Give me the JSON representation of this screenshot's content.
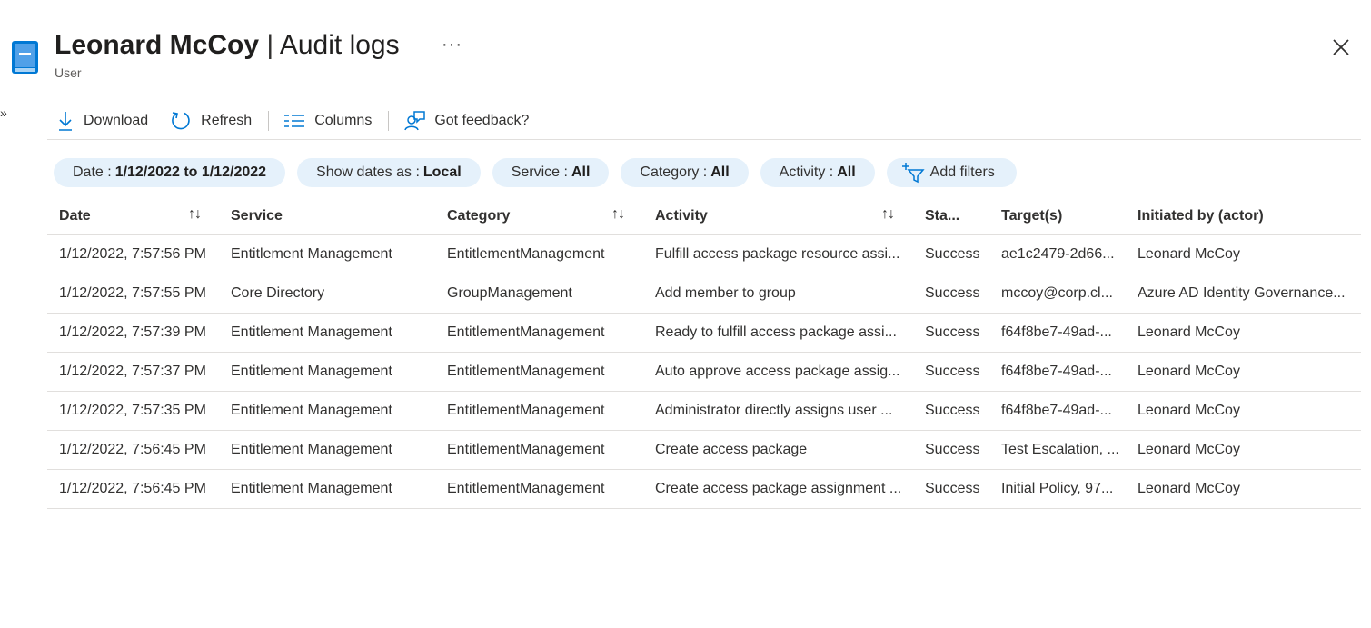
{
  "header": {
    "title_name": "Leonard McCoy",
    "title_sep": "|",
    "title_page": "Audit logs",
    "subtitle": "User",
    "more_label": "···"
  },
  "toolbar": {
    "download": "Download",
    "refresh": "Refresh",
    "columns": "Columns",
    "feedback": "Got feedback?"
  },
  "filters": [
    {
      "label": "Date :",
      "value": "1/12/2022 to 1/12/2022"
    },
    {
      "label": "Show dates as :",
      "value": "Local"
    },
    {
      "label": "Service :",
      "value": "All"
    },
    {
      "label": "Category :",
      "value": "All"
    },
    {
      "label": "Activity :",
      "value": "All"
    }
  ],
  "add_filters": "Add filters",
  "columns": {
    "date": "Date",
    "service": "Service",
    "category": "Category",
    "activity": "Activity",
    "status": "Sta...",
    "target": "Target(s)",
    "actor": "Initiated by (actor)"
  },
  "rows": [
    {
      "date": "1/12/2022, 7:57:56 PM",
      "service": "Entitlement Management",
      "category": "EntitlementManagement",
      "activity": "Fulfill access package resource assi...",
      "status": "Success",
      "target": "ae1c2479-2d66...",
      "actor": "Leonard McCoy"
    },
    {
      "date": "1/12/2022, 7:57:55 PM",
      "service": "Core Directory",
      "category": "GroupManagement",
      "activity": "Add member to group",
      "status": "Success",
      "target": "mccoy@corp.cl...",
      "actor": "Azure AD Identity Governance..."
    },
    {
      "date": "1/12/2022, 7:57:39 PM",
      "service": "Entitlement Management",
      "category": "EntitlementManagement",
      "activity": "Ready to fulfill access package assi...",
      "status": "Success",
      "target": "f64f8be7-49ad-...",
      "actor": "Leonard McCoy"
    },
    {
      "date": "1/12/2022, 7:57:37 PM",
      "service": "Entitlement Management",
      "category": "EntitlementManagement",
      "activity": "Auto approve access package assig...",
      "status": "Success",
      "target": "f64f8be7-49ad-...",
      "actor": "Leonard McCoy"
    },
    {
      "date": "1/12/2022, 7:57:35 PM",
      "service": "Entitlement Management",
      "category": "EntitlementManagement",
      "activity": "Administrator directly assigns user ...",
      "status": "Success",
      "target": "f64f8be7-49ad-...",
      "actor": "Leonard McCoy"
    },
    {
      "date": "1/12/2022, 7:56:45 PM",
      "service": "Entitlement Management",
      "category": "EntitlementManagement",
      "activity": "Create access package",
      "status": "Success",
      "target": "Test Escalation, ...",
      "actor": "Leonard McCoy"
    },
    {
      "date": "1/12/2022, 7:56:45 PM",
      "service": "Entitlement Management",
      "category": "EntitlementManagement",
      "activity": "Create access package assignment ...",
      "status": "Success",
      "target": "Initial Policy, 97...",
      "actor": "Leonard McCoy"
    }
  ],
  "sort_glyph": "↑↓",
  "expand_glyph": "»",
  "colors": {
    "accent": "#0078d4",
    "pill_bg": "#e5f1fb",
    "divider": "#e1dfdd"
  },
  "icons": [
    "audit-log-icon",
    "download-icon",
    "refresh-icon",
    "columns-icon",
    "feedback-icon",
    "add-filter-icon",
    "close-icon"
  ]
}
